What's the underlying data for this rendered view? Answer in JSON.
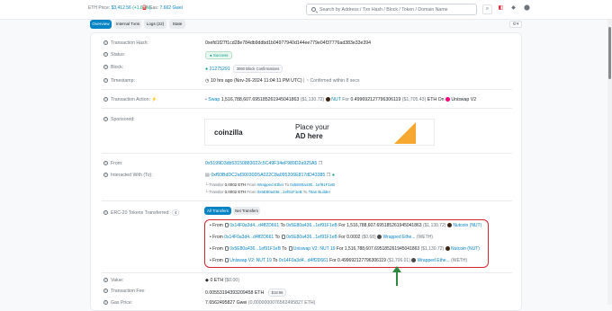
{
  "topbar": {
    "eth_price_label": "ETH Price:",
    "eth_price": "$3,412.56",
    "eth_change": "(+1.65%)",
    "gas_label": "Gas:",
    "gas_value": "7.662 Gwei",
    "search_placeholder": "Search by Address / Txn Hash / Block / Token / Domain Name",
    "icons": [
      "search-icon",
      "light-mode-icon",
      "eth-icon",
      "signin-icon"
    ]
  },
  "tabs": [
    {
      "label": "Overview",
      "active": true
    },
    {
      "label": "Internal Txns",
      "active": false
    },
    {
      "label": "Logs (22)",
      "active": false
    },
    {
      "label": "State",
      "active": false
    }
  ],
  "fields": {
    "tx_hash": {
      "label": "Transaction Hash:",
      "value": "0xefd1f27f1cd28e784db9ddbd1b04977940d144ee779e04f37776ad383e33e394"
    },
    "status": {
      "label": "Status:",
      "value": "Success"
    },
    "block": {
      "label": "Block:",
      "value": "21275291",
      "confirmations": "3060 Block Confirmations"
    },
    "timestamp": {
      "label": "Timestamp:",
      "value": "10 hrs ago (Nov-26-2024 11:04:11 PM UTC)",
      "confirmed": "Confirmed within 8 secs"
    },
    "action": {
      "label": "Transaction Action:",
      "prefix": "Swap",
      "amount": "1,516,788,607.695185261945041863",
      "usd": "($1,130.72)",
      "token": "NUT",
      "for_text": "For",
      "eth_amount": "0.499692127796306119",
      "eth_usd": "($1,705.43)",
      "eth_on": "ETH On",
      "dex": "Uniswap V2"
    },
    "sponsored": {
      "label": "Sponsored:",
      "ad_logo": "coinzilla",
      "ad_line1": "Place your",
      "ad_line2": "AD here"
    },
    "from": {
      "label": "From:",
      "value": "0x5199D3db53150883022c5C49F34eF989D2a925A5"
    },
    "to": {
      "label": "Interacted With (To):",
      "value": "0xf93BdDC2af30030D5A022C8a095206E817dD43385",
      "transfers": [
        {
          "prefix": "└ Transfer",
          "amount": "0.0002 ETH",
          "from_label": "From",
          "from": "Wrapped Ether",
          "to_label": "To",
          "to": "0x5E80a436...1ef91F1eB"
        },
        {
          "prefix": "└ Transfer",
          "amount": "0.0002 ETH",
          "from_label": "From",
          "from": "0x5E80a436...1ef91F1eB",
          "to_label": "To",
          "to": "Titan Builder"
        }
      ]
    },
    "erc20": {
      "label": "ERC-20 Tokens Transferred:",
      "count": "4",
      "subtab_all": "All Transfers",
      "subtab_net": "Net Transfers",
      "rows": [
        {
          "from_label": "From",
          "from": "0x14F0a3d4...d4ff2D661",
          "to_label": "To",
          "to": "0x5E80a436...1ef91F1eB",
          "for_label": "For",
          "amount": "1,516,788,607.695185261945041863",
          "usd": "($1,130.72)",
          "token": "Nutcoin (NUT)",
          "token_color": "#3b2412"
        },
        {
          "from_label": "From",
          "from": "0x14F0a3d4...d4ff2D661",
          "to_label": "To",
          "to": "0x5E80a436...1ef91F1eB",
          "for_label": "For",
          "amount": "0.0002",
          "usd": "($0.68)",
          "token": "Wrapped Ethe...",
          "token_sym": "(WETH)",
          "token_color": "#4a4a4a"
        },
        {
          "from_label": "From",
          "from": "0x5E80a436...1ef91F1eB",
          "to_label": "To",
          "to": "Uniswap V2: NUT 19",
          "for_label": "For",
          "amount": "1,516,788,607.695185261945041863",
          "usd": "($1,130.72)",
          "token": "Nutcoin (NUT)",
          "token_color": "#3b2412"
        },
        {
          "from_label": "From",
          "from": "Uniswap V2: NUT 19",
          "to_label": "To",
          "to": "0x14F0a3d4...d4ff2D661",
          "for_label": "For",
          "amount": "0.499692127796306119",
          "usd": "($1,706.01)",
          "token": "Wrapped Ethe...",
          "token_sym": "(WETH)",
          "token_color": "#4a4a4a"
        }
      ]
    },
    "value": {
      "label": "Value:",
      "value": "0 ETH",
      "usd": "($0.00)"
    },
    "fee": {
      "label": "Transaction Fee:",
      "value": "0.00553194393209458 ETH",
      "usd": "$18.88"
    },
    "gas_price": {
      "label": "Gas Price:",
      "value": "7.6562495827 Gwei",
      "eth": "(0.0000000076562495827 ETH)"
    }
  },
  "colors": {
    "accent": "#0784c3",
    "highlight": "#d9232e",
    "arrow": "#2e8b3d",
    "success": "#00a186"
  }
}
